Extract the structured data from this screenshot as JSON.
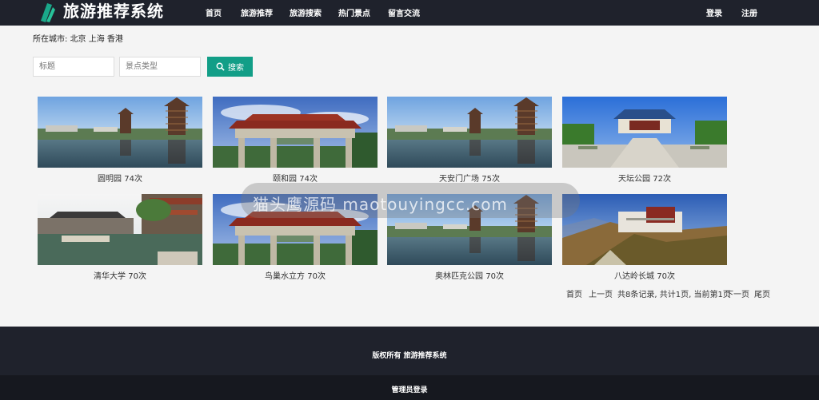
{
  "header": {
    "title": "旅游推荐系统",
    "nav": [
      "首页",
      "旅游推荐",
      "旅游搜索",
      "热门景点",
      "留言交流"
    ],
    "login": "登录",
    "register": "注册"
  },
  "city": {
    "label": "所在城市:",
    "cities": "北京 上海 香港"
  },
  "search": {
    "title_placeholder": "标题",
    "type_placeholder": "景点类型",
    "button": "搜索"
  },
  "cards": [
    {
      "name": "圆明园 74次",
      "image": "pagoda"
    },
    {
      "name": "颐和园 74次",
      "image": "archway"
    },
    {
      "name": "天安门广场 75次",
      "image": "pagoda"
    },
    {
      "name": "天坛公园 72次",
      "image": "temple"
    },
    {
      "name": "清华大学 70次",
      "image": "river"
    },
    {
      "name": "鸟巢水立方 70次",
      "image": "archway"
    },
    {
      "name": "奥林匹克公园 70次",
      "image": "pagoda"
    },
    {
      "name": "八达岭长城 70次",
      "image": "palace"
    }
  ],
  "pager": {
    "first": "首页",
    "prev": "上一页",
    "info": "共8条记录, 共计1页, 当前第1页",
    "next": "下一页",
    "last": "尾页"
  },
  "footer": {
    "copyright": "版权所有 旅游推荐系统",
    "admin_login": "管理员登录"
  },
  "watermark": "猫头鹰源码 maotouyingcc.com",
  "colors": {
    "header_bg": "#1f222c",
    "accent": "#129e87",
    "logo": "#1aa88a"
  }
}
